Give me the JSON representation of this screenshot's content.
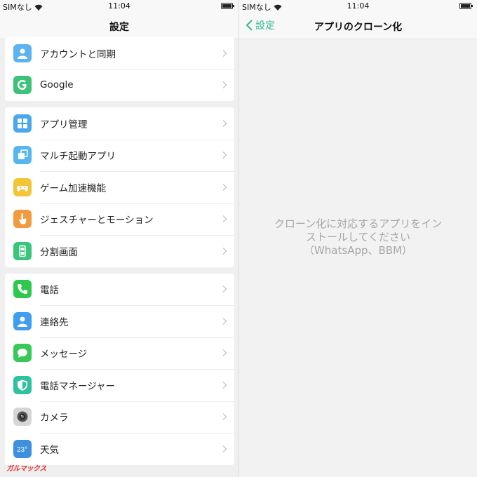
{
  "status_left": {
    "carrier": "SIMなし",
    "time": "11:04"
  },
  "status_right": {
    "carrier": "SIMなし",
    "time": "11:04"
  },
  "settings": {
    "title": "設定",
    "groups": [
      {
        "items": [
          {
            "label": "アカウントと同期",
            "icon": "account-icon",
            "color": "#5bb3ef"
          },
          {
            "label": "Google",
            "icon": "google-icon",
            "color": "#3dc27a"
          }
        ]
      },
      {
        "items": [
          {
            "label": "アプリ管理",
            "icon": "apps-grid-icon",
            "color": "#4aa7ec"
          },
          {
            "label": "マルチ起動アプリ",
            "icon": "multi-launch-icon",
            "color": "#56b6ee"
          },
          {
            "label": "ゲーム加速機能",
            "icon": "gamepad-icon",
            "color": "#f3c436"
          },
          {
            "label": "ジェスチャーとモーション",
            "icon": "gesture-hand-icon",
            "color": "#f29a3f"
          },
          {
            "label": "分割画面",
            "icon": "split-screen-icon",
            "color": "#39c67b"
          }
        ]
      },
      {
        "items": [
          {
            "label": "電話",
            "icon": "phone-icon",
            "color": "#2ec84e"
          },
          {
            "label": "連絡先",
            "icon": "contacts-icon",
            "color": "#3e9ef0"
          },
          {
            "label": "メッセージ",
            "icon": "message-icon",
            "color": "#38c95a"
          },
          {
            "label": "電話マネージャー",
            "icon": "shield-icon",
            "color": "#2fc2a0"
          },
          {
            "label": "カメラ",
            "icon": "camera-icon",
            "color": "#d6d6d6"
          },
          {
            "label": "天気",
            "icon": "weather-icon",
            "color": "#3d8fe0"
          }
        ]
      }
    ]
  },
  "clone": {
    "back_label": "設定",
    "title": "アプリのクローン化",
    "empty_line1": "クローン化に対応するアプリをイン",
    "empty_line2": "ストールしてください",
    "empty_line3": "（WhatsApp、BBM）"
  },
  "watermark": "ガルマックス"
}
